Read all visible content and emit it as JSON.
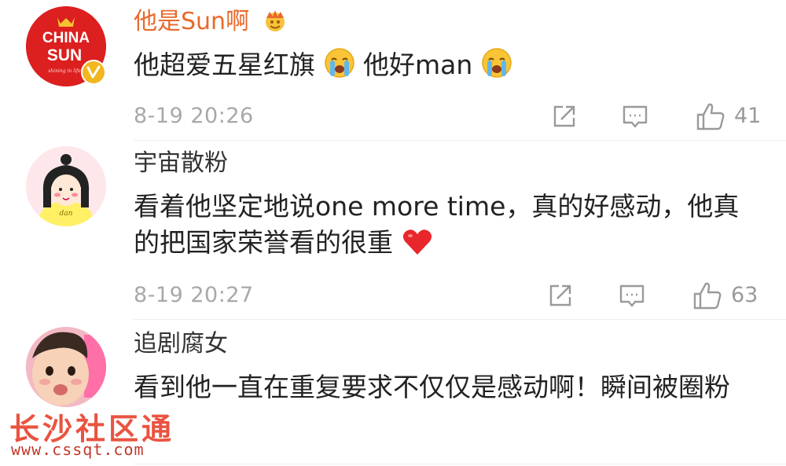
{
  "comments": [
    {
      "avatar": "china-sun-logo",
      "avatar_text_1": "CHINA",
      "avatar_text_2": "SUN",
      "avatar_tagline": "shining in life",
      "username": "他是Sun啊",
      "badge": "crown-icon",
      "verified": "verified-badge-icon",
      "text": "他超爱五星红旗",
      "emoji_1": "crying-face-emoji",
      "text_2": "他好man",
      "emoji_2": "crying-face-emoji",
      "time": "8-19 20:26",
      "likes": "41"
    },
    {
      "avatar": "cartoon-girl-avatar",
      "avatar_caption": "dan",
      "username": "宇宙散粉",
      "text": "看着他坚定地说one more time，真的好感动，他真的把国家荣誉看的很重",
      "emoji_1": "red-heart-emoji",
      "time": "8-19 20:27",
      "likes": "63"
    },
    {
      "avatar": "baby-photo-avatar",
      "username": "追剧腐女",
      "text": "看到他一直在重复要求不仅仅是感动啊！瞬间被圈粉"
    }
  ],
  "icons": {
    "share": "share-icon",
    "comment": "comment-icon",
    "like": "thumbs-up-icon"
  },
  "watermark": {
    "text": "长沙社区通",
    "url": "www.cssqt.com"
  },
  "colors": {
    "vip_name": "#e8692b",
    "meta": "#a8a8a8",
    "watermark": "#e8412c"
  }
}
